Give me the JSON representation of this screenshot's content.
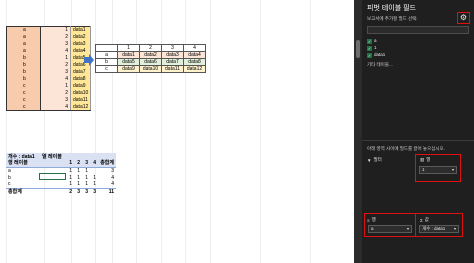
{
  "source_table": {
    "rows": [
      [
        "a",
        "1",
        "data1"
      ],
      [
        "a",
        "2",
        "data2"
      ],
      [
        "a",
        "3",
        "data3"
      ],
      [
        "a",
        "4",
        "data4"
      ],
      [
        "b",
        "1",
        "data5"
      ],
      [
        "b",
        "2",
        "data6"
      ],
      [
        "b",
        "3",
        "data7"
      ],
      [
        "b",
        "4",
        "data8"
      ],
      [
        "c",
        "1",
        "data9"
      ],
      [
        "c",
        "2",
        "data10"
      ],
      [
        "c",
        "3",
        "data11"
      ],
      [
        "c",
        "4",
        "data12"
      ]
    ]
  },
  "transformed_table": {
    "headers": [
      "",
      "1",
      "2",
      "3",
      "4"
    ],
    "rows": [
      [
        "a",
        "data1",
        "data2",
        "data3",
        "data4"
      ],
      [
        "b",
        "data5",
        "data6",
        "data7",
        "data8"
      ],
      [
        "c",
        "data9",
        "data10",
        "data11",
        "data12"
      ]
    ]
  },
  "pivot": {
    "header1": [
      "개수 : data1",
      "열 레이블",
      "",
      "",
      "",
      ""
    ],
    "header2": [
      "행 레이블",
      "",
      "1",
      "2",
      "3",
      "4",
      "총합계"
    ],
    "rows": [
      [
        "a",
        "",
        "1",
        "1",
        "1",
        "",
        "3"
      ],
      [
        "b",
        "",
        "1",
        "1",
        "1",
        "1",
        "4"
      ],
      [
        "c",
        "",
        "1",
        "1",
        "1",
        "1",
        "4"
      ]
    ],
    "total": [
      "총합계",
      "",
      "2",
      "3",
      "3",
      "3",
      "11"
    ]
  },
  "panel": {
    "title": "피벗 테이블 필드",
    "subtitle": "보고서에 추가할 필드 선택:",
    "gear_icon": "gear-icon",
    "fields": [
      {
        "label": "a",
        "checked": true
      },
      {
        "label": "1",
        "checked": true
      },
      {
        "label": "data1",
        "checked": true
      }
    ],
    "more_tables": "기타 테이블...",
    "drag_hint": "아래 영역 사이에 필드를 끌어 놓으십시오.",
    "filter_label": "필터",
    "columns_label": "열",
    "columns_value": "1",
    "rows_label": "행",
    "rows_value": "a",
    "values_label": "값",
    "values_value": "개수 : data1"
  },
  "colors": {
    "panel_bg": "#1f1f1f",
    "highlight_box": "#e01010",
    "arrow": "#4472c4"
  }
}
